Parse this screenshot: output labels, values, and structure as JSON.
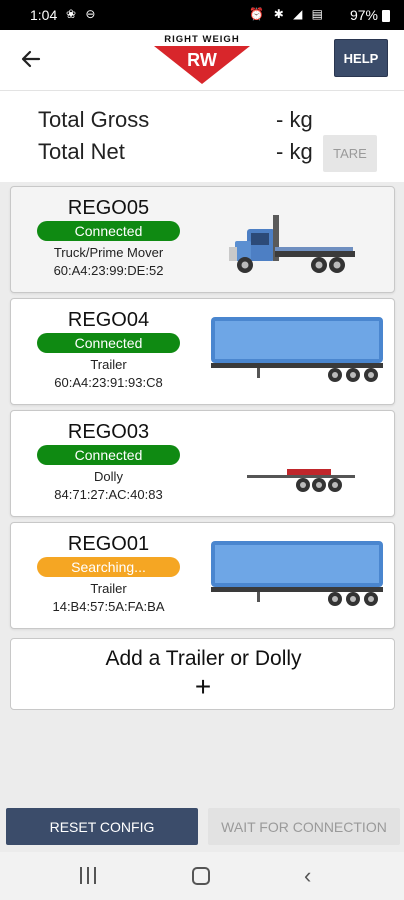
{
  "status_bar": {
    "time": "1:04",
    "left_icons": "❀ ⊖",
    "right_icons": "⏰ ✱ ◢ ▤",
    "battery": "97%"
  },
  "header": {
    "logo_text": "RIGHT WEIGH",
    "logo_mark": "RW",
    "help_label": "HELP",
    "colors": {
      "button": "#3b4c6a",
      "logo_red": "#d8262b"
    }
  },
  "totals": {
    "gross_label": "Total Gross",
    "gross_value": "- kg",
    "net_label": "Total Net",
    "net_value": "- kg",
    "tare_label": "TARE"
  },
  "devices": [
    {
      "name": "REGO05",
      "status": "Connected",
      "status_color": "#0f8a12",
      "type": "Truck/Prime Mover",
      "mac": "60:A4:23:99:DE:52",
      "image": "prime-mover-truck"
    },
    {
      "name": "REGO04",
      "status": "Connected",
      "status_color": "#0f8a12",
      "type": "Trailer",
      "mac": "60:A4:23:91:93:C8",
      "image": "curtainsider-trailer"
    },
    {
      "name": "REGO03",
      "status": "Connected",
      "status_color": "#0f8a12",
      "type": "Dolly",
      "mac": "84:71:27:AC:40:83",
      "image": "dolly"
    },
    {
      "name": "REGO01",
      "status": "Searching...",
      "status_color": "#f5a623",
      "type": "Trailer",
      "mac": "14:B4:57:5A:FA:BA",
      "image": "curtainsider-trailer"
    }
  ],
  "add_card": {
    "label": "Add a Trailer or Dolly",
    "icon": "plus-icon"
  },
  "buttons": {
    "reset_label": "RESET CONFIG",
    "wait_label": "WAIT FOR CONNECTION"
  }
}
